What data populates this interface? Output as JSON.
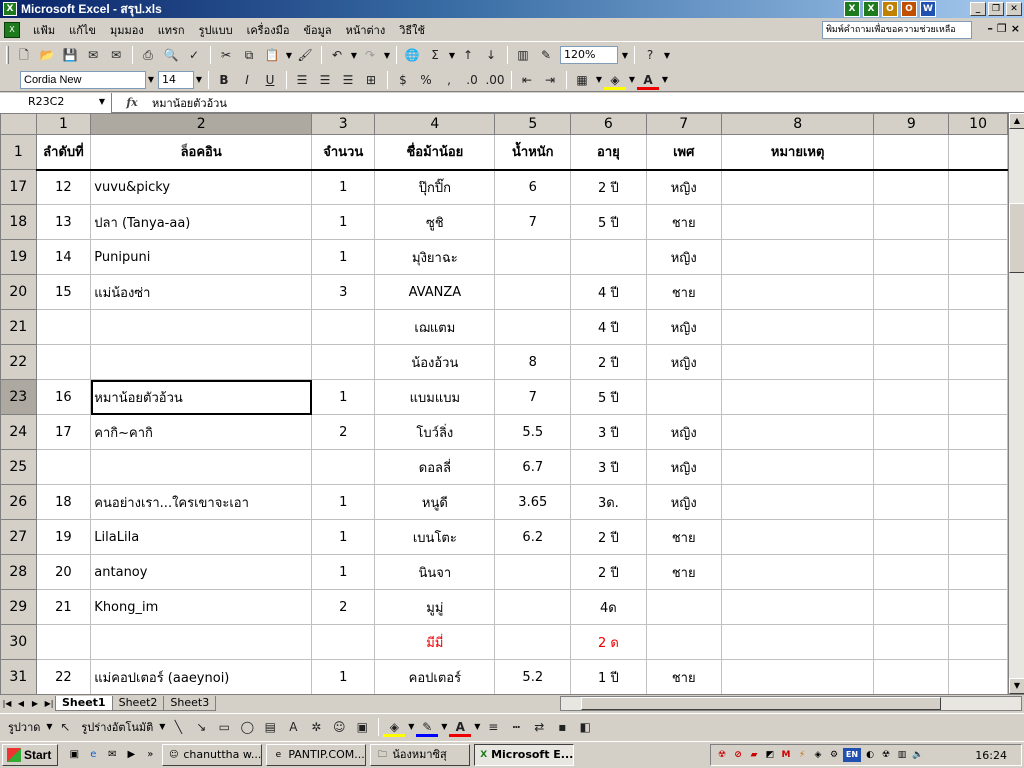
{
  "window": {
    "title": "Microsoft Excel - สรุป.xls"
  },
  "tray_apps": [
    "X",
    "X",
    "O",
    "O",
    "W"
  ],
  "menu": {
    "items": [
      "แฟ้ม",
      "แก้ไข",
      "มุมมอง",
      "แทรก",
      "รูปแบบ",
      "เครื่องมือ",
      "ข้อมูล",
      "หน้าต่าง",
      "วิธีใช้"
    ],
    "help_placeholder": "พิมพ์คำถามเพื่อขอความช่วยเหลือ"
  },
  "toolbar": {
    "zoom": "120%",
    "font_name": "Cordia New",
    "font_size": "14"
  },
  "formula_bar": {
    "cell_ref": "R23C2",
    "fx_label": "fx",
    "content": "หมาน้อยตัวอ้วน"
  },
  "sheet": {
    "column_headers": [
      "1",
      "2",
      "3",
      "4",
      "5",
      "6",
      "7",
      "8",
      "9",
      "10"
    ],
    "header_row": {
      "row": "1",
      "cells": [
        "ลำดับที่",
        "ล็อคอิน",
        "จำนวน",
        "ชื่อม้าน้อย",
        "น้ำหนัก",
        "อายุ",
        "เพศ",
        "หมายเหตุ",
        "",
        ""
      ]
    },
    "rows": [
      {
        "row": "17",
        "cells": [
          "12",
          "vuvu&picky",
          "1",
          "ปุ๊กปิ๊ก",
          "6",
          "2 ปี",
          "หญิง",
          "",
          "",
          ""
        ]
      },
      {
        "row": "18",
        "cells": [
          "13",
          "ปลา (Tanya-aa)",
          "1",
          "ซูชิ",
          "7",
          "5 ปี",
          "ชาย",
          "",
          "",
          ""
        ]
      },
      {
        "row": "19",
        "cells": [
          "14",
          "Punipuni",
          "1",
          "มุงิยาฉะ",
          "",
          "",
          "หญิง",
          "",
          "",
          ""
        ]
      },
      {
        "row": "20",
        "cells": [
          "15",
          "แม่น้องซ่า",
          "3",
          "AVANZA",
          "",
          "4 ปี",
          "ชาย",
          "",
          "",
          ""
        ]
      },
      {
        "row": "21",
        "cells": [
          "",
          "",
          "",
          "เฌแตม",
          "",
          "4 ปี",
          "หญิง",
          "",
          "",
          ""
        ]
      },
      {
        "row": "22",
        "cells": [
          "",
          "",
          "",
          "น้องอ้วน",
          "8",
          "2 ปี",
          "หญิง",
          "",
          "",
          ""
        ]
      },
      {
        "row": "23",
        "cells": [
          "16",
          "หมาน้อยตัวอ้วน",
          "1",
          "แบมแบม",
          "7",
          "5 ปี",
          "",
          "",
          "",
          ""
        ]
      },
      {
        "row": "24",
        "cells": [
          "17",
          "คากิ~คากิ",
          "2",
          "โบว์ลิ่ง",
          "5.5",
          "3 ปี",
          "หญิง",
          "",
          "",
          ""
        ]
      },
      {
        "row": "25",
        "cells": [
          "",
          "",
          "",
          "ดอลลี่",
          "6.7",
          "3 ปี",
          "หญิง",
          "",
          "",
          ""
        ]
      },
      {
        "row": "26",
        "cells": [
          "18",
          "คนอย่างเรา...ใครเขาจะเอา",
          "1",
          "หนูดี",
          "3.65",
          "3ด.",
          "หญิง",
          "",
          "",
          ""
        ]
      },
      {
        "row": "27",
        "cells": [
          "19",
          "LilaLila",
          "1",
          "เบนโตะ",
          "6.2",
          "2 ปี",
          "ชาย",
          "",
          "",
          ""
        ]
      },
      {
        "row": "28",
        "cells": [
          "20",
          "antanoy",
          "1",
          "นินจา",
          "",
          "2 ปี",
          "ชาย",
          "",
          "",
          ""
        ]
      },
      {
        "row": "29",
        "cells": [
          "21",
          "Khong_im",
          "2",
          "มูมู่",
          "",
          "4ด",
          "",
          "",
          "",
          ""
        ]
      },
      {
        "row": "30",
        "cells": [
          "",
          "",
          "",
          "มีมี่",
          "",
          "2 ด",
          "",
          "",
          "",
          ""
        ]
      },
      {
        "row": "31",
        "cells": [
          "22",
          "แม่คอปเตอร์ (aaeynoi)",
          "1",
          "คอปเตอร์",
          "5.2",
          "1 ปี",
          "ชาย",
          "",
          "",
          ""
        ]
      }
    ]
  },
  "sheet_tabs": [
    "Sheet1",
    "Sheet2",
    "Sheet3"
  ],
  "drawing_toolbar": {
    "draw_label": "รูปวาด",
    "autoshapes_label": "รูปร่างอัตโนมัติ"
  },
  "taskbar": {
    "start_label": "Start",
    "buttons": [
      {
        "label": "chanuttha w...",
        "active": false
      },
      {
        "label": "PANTIP.COM...",
        "active": false
      },
      {
        "label": "น้องหมาซิสุ",
        "active": false
      },
      {
        "label": "Microsoft E...",
        "active": true
      }
    ],
    "clock": "16:24",
    "lang": "EN"
  },
  "colors": {
    "title_gradient_start": "#0a246a",
    "red_text": "#ee0000",
    "grid_line": "#c0c0c0"
  }
}
